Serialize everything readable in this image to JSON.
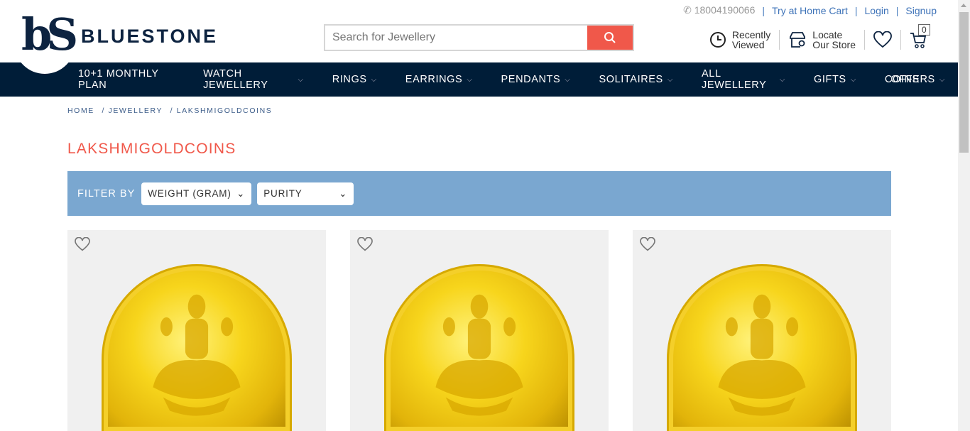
{
  "header": {
    "phone": "18004190066",
    "links": [
      "Try at Home Cart",
      "Login",
      "Signup"
    ],
    "brand": "BLUESTONE",
    "logo_mark": "bS",
    "search_placeholder": "Search for Jewellery",
    "recently_viewed": [
      "Recently",
      "Viewed"
    ],
    "locate_store": [
      "Locate",
      "Our Store"
    ],
    "cart_count": "0"
  },
  "nav": [
    "10+1 MONTHLY PLAN",
    "WATCH JEWELLERY",
    "RINGS",
    "EARRINGS",
    "PENDANTS",
    "SOLITAIRES",
    "ALL JEWELLERY",
    "GIFTS",
    "COINS",
    "OFFERS"
  ],
  "breadcrumb": [
    "HOME",
    "/ JEWELLERY",
    "/ LAKSHMIGOLDCOINS"
  ],
  "page_title": "LAKSHMIGOLDCOINS",
  "filter": {
    "label": "FILTER BY",
    "weight": "WEIGHT (GRAM)",
    "purity": "PURITY"
  },
  "colors": {
    "navy": "#001d38",
    "accent": "#f0584a",
    "filter_bg": "#7aa7d0"
  }
}
